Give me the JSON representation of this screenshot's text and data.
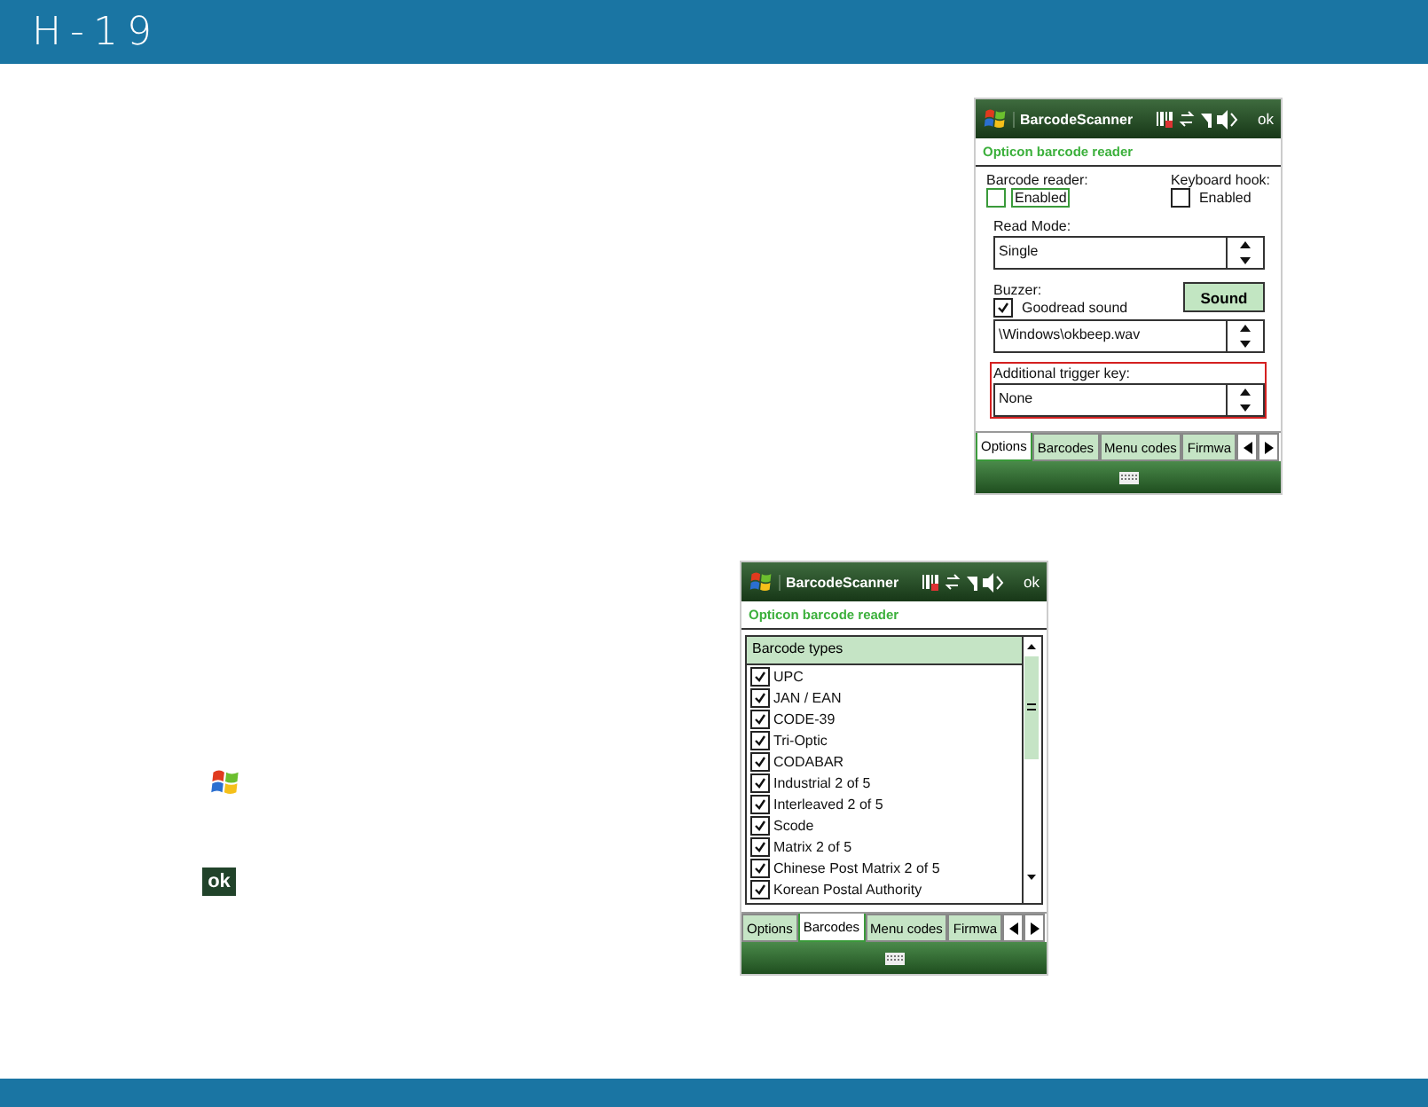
{
  "header": {
    "title": "H-19"
  },
  "inline_icons": {
    "ok": "ok"
  },
  "screens": [
    {
      "kind": "options",
      "title": "BarcodeScanner",
      "ok": "ok",
      "subtitle": "Opticon barcode reader",
      "checks": [
        {
          "label": "Barcode reader:",
          "option": "Enabled",
          "checked": false,
          "focused": true
        },
        {
          "label": "Keyboard hook:",
          "option": "Enabled",
          "checked": false,
          "focused": false
        }
      ],
      "read_mode": {
        "label": "Read Mode:",
        "value": "Single"
      },
      "buzzer": {
        "label": "Buzzer:",
        "option": "Goodread sound",
        "checked": true,
        "button": "Sound",
        "file": "\\Windows\\okbeep.wav"
      },
      "trigger": {
        "label": "Additional trigger key:",
        "value": "None"
      },
      "tabs": [
        {
          "label": "Options",
          "selected": true
        },
        {
          "label": "Barcodes",
          "selected": false
        },
        {
          "label": "Menu codes",
          "selected": false
        },
        {
          "label": "Firmwa",
          "selected": false
        }
      ]
    },
    {
      "kind": "barcodes",
      "title": "BarcodeScanner",
      "ok": "ok",
      "subtitle": "Opticon barcode reader",
      "list_header": "Barcode types",
      "items": [
        {
          "label": "UPC",
          "checked": true
        },
        {
          "label": "JAN / EAN",
          "checked": true
        },
        {
          "label": "CODE-39",
          "checked": true
        },
        {
          "label": "Tri-Optic",
          "checked": true
        },
        {
          "label": "CODABAR",
          "checked": true
        },
        {
          "label": "Industrial 2 of 5",
          "checked": true
        },
        {
          "label": "Interleaved 2 of 5",
          "checked": true
        },
        {
          "label": "Scode",
          "checked": true
        },
        {
          "label": "Matrix 2 of 5",
          "checked": true
        },
        {
          "label": "Chinese Post Matrix 2 of 5",
          "checked": true
        },
        {
          "label": "Korean Postal Authority",
          "checked": true
        }
      ],
      "tabs": [
        {
          "label": "Options",
          "selected": false
        },
        {
          "label": "Barcodes",
          "selected": true
        },
        {
          "label": "Menu codes",
          "selected": false
        },
        {
          "label": "Firmwa",
          "selected": false
        }
      ]
    }
  ]
}
